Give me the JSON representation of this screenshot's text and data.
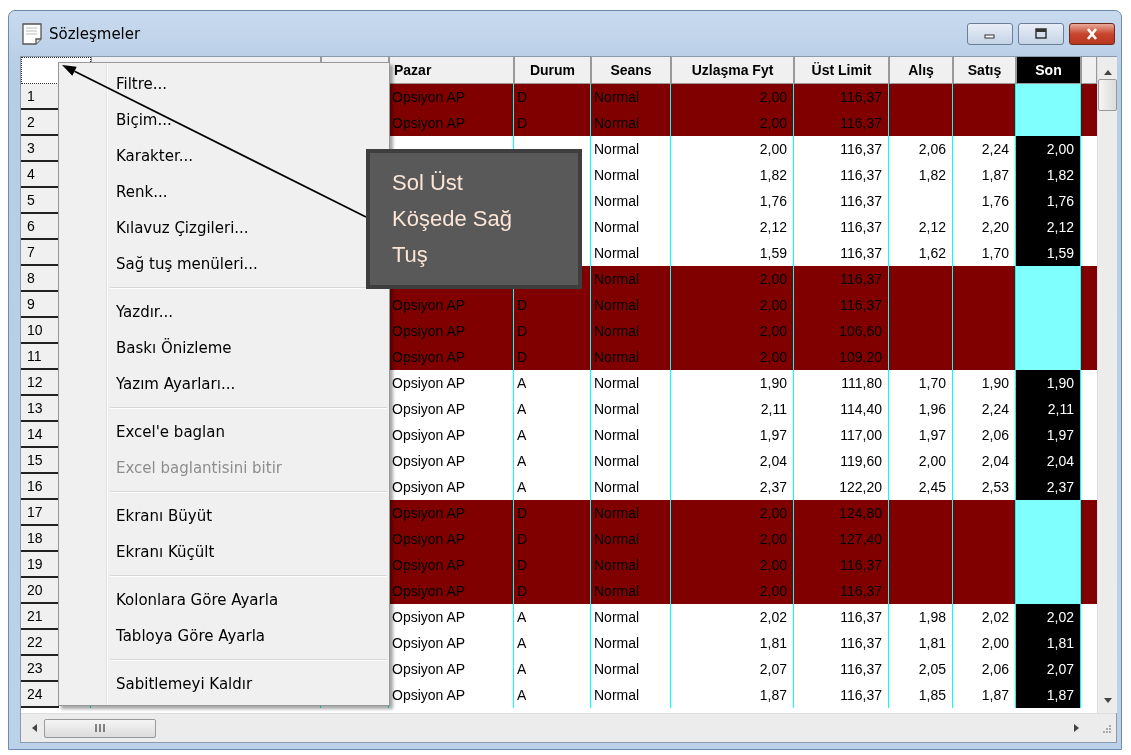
{
  "window": {
    "title": "Sözleşmeler"
  },
  "table": {
    "columns": [
      {
        "label": "Pazar",
        "selected": false
      },
      {
        "label": "Durum",
        "selected": false
      },
      {
        "label": "Seans",
        "selected": false
      },
      {
        "label": "Uzlaşma Fyt",
        "selected": false
      },
      {
        "label": "Üst Limit",
        "selected": false
      },
      {
        "label": "Alış",
        "selected": false
      },
      {
        "label": "Satış",
        "selected": false
      },
      {
        "label": "Son",
        "selected": true
      }
    ],
    "rows": [
      {
        "number": "1",
        "halted": true,
        "cells": [
          "Opsiyon AP",
          "D",
          "Normal",
          "2,00",
          "116,37",
          null,
          null,
          null
        ]
      },
      {
        "number": "2",
        "halted": true,
        "cells": [
          "Opsiyon AP",
          "D",
          "Normal",
          "2,00",
          "116,37",
          null,
          null,
          null
        ]
      },
      {
        "number": "3",
        "halted": false,
        "cells": [
          null,
          null,
          "Normal",
          "2,00",
          "116,37",
          "2,06",
          "2,24",
          "2,00"
        ]
      },
      {
        "number": "4",
        "halted": false,
        "cells": [
          null,
          null,
          "Normal",
          "1,82",
          "116,37",
          "1,82",
          "1,87",
          "1,82"
        ]
      },
      {
        "number": "5",
        "halted": false,
        "cells": [
          null,
          null,
          "Normal",
          "1,76",
          "116,37",
          null,
          "1,76",
          "1,76"
        ]
      },
      {
        "number": "6",
        "halted": false,
        "cells": [
          null,
          null,
          "Normal",
          "2,12",
          "116,37",
          "2,12",
          "2,20",
          "2,12"
        ]
      },
      {
        "number": "7",
        "halted": false,
        "cells": [
          null,
          null,
          "Normal",
          "1,59",
          "116,37",
          "1,62",
          "1,70",
          "1,59"
        ]
      },
      {
        "number": "8",
        "halted": true,
        "cells": [
          null,
          null,
          "Normal",
          "2,00",
          "116,37",
          null,
          null,
          null
        ]
      },
      {
        "number": "9",
        "halted": true,
        "cells": [
          "Opsiyon AP",
          "D",
          "Normal",
          "2,00",
          "116,37",
          null,
          null,
          null
        ]
      },
      {
        "number": "10",
        "halted": true,
        "cells": [
          "Opsiyon AP",
          "D",
          "Normal",
          "2,00",
          "106,60",
          null,
          null,
          null
        ]
      },
      {
        "number": "11",
        "halted": true,
        "cells": [
          "Opsiyon AP",
          "D",
          "Normal",
          "2,00",
          "109,20",
          null,
          null,
          null
        ]
      },
      {
        "number": "12",
        "halted": false,
        "cells": [
          "Opsiyon AP",
          "A",
          "Normal",
          "1,90",
          "111,80",
          "1,70",
          "1,90",
          "1,90"
        ]
      },
      {
        "number": "13",
        "halted": false,
        "cells": [
          "Opsiyon AP",
          "A",
          "Normal",
          "2,11",
          "114,40",
          "1,96",
          "2,24",
          "2,11"
        ]
      },
      {
        "number": "14",
        "halted": false,
        "cells": [
          "Opsiyon AP",
          "A",
          "Normal",
          "1,97",
          "117,00",
          "1,97",
          "2,06",
          "1,97"
        ]
      },
      {
        "number": "15",
        "halted": false,
        "cells": [
          "Opsiyon AP",
          "A",
          "Normal",
          "2,04",
          "119,60",
          "2,00",
          "2,04",
          "2,04"
        ]
      },
      {
        "number": "16",
        "halted": false,
        "cells": [
          "Opsiyon AP",
          "A",
          "Normal",
          "2,37",
          "122,20",
          "2,45",
          "2,53",
          "2,37"
        ]
      },
      {
        "number": "17",
        "halted": true,
        "cells": [
          "Opsiyon AP",
          "D",
          "Normal",
          "2,00",
          "124,80",
          null,
          null,
          null
        ]
      },
      {
        "number": "18",
        "halted": true,
        "cells": [
          "Opsiyon AP",
          "D",
          "Normal",
          "2,00",
          "127,40",
          null,
          null,
          null
        ]
      },
      {
        "number": "19",
        "halted": true,
        "cells": [
          "Opsiyon AP",
          "D",
          "Normal",
          "2,00",
          "116,37",
          null,
          null,
          null
        ]
      },
      {
        "number": "20",
        "halted": true,
        "cells": [
          "Opsiyon AP",
          "D",
          "Normal",
          "2,00",
          "116,37",
          null,
          null,
          null
        ]
      },
      {
        "number": "21",
        "halted": false,
        "cells": [
          "Opsiyon AP",
          "A",
          "Normal",
          "2,02",
          "116,37",
          "1,98",
          "2,02",
          "2,02"
        ]
      },
      {
        "number": "22",
        "halted": false,
        "cells": [
          "Opsiyon AP",
          "A",
          "Normal",
          "1,81",
          "116,37",
          "1,81",
          "2,00",
          "1,81"
        ]
      },
      {
        "number": "23",
        "halted": false,
        "cells": [
          "Opsiyon AP",
          "A",
          "Normal",
          "2,07",
          "116,37",
          "2,05",
          "2,06",
          "2,07"
        ]
      },
      {
        "number": "24",
        "halted": false,
        "cells": [
          "Opsiyon AP",
          "A",
          "Normal",
          "1,87",
          "116,37",
          "1,85",
          "1,87",
          "1,87"
        ]
      }
    ]
  },
  "context_menu": {
    "groups": [
      [
        {
          "label": "Filtre...",
          "disabled": false
        },
        {
          "label": "Biçim...",
          "disabled": false
        },
        {
          "label": "Karakter...",
          "disabled": false
        },
        {
          "label": "Renk...",
          "disabled": false
        },
        {
          "label": "Kılavuz Çizgileri...",
          "disabled": false
        },
        {
          "label": "Sağ tuş menüleri...",
          "disabled": false
        }
      ],
      [
        {
          "label": "Yazdır...",
          "disabled": false
        },
        {
          "label": "Baskı Önizleme",
          "disabled": false
        },
        {
          "label": "Yazım Ayarları...",
          "disabled": false
        }
      ],
      [
        {
          "label": "Excel'e baglan",
          "disabled": false
        },
        {
          "label": "Excel baglantisini bitir",
          "disabled": true
        }
      ],
      [
        {
          "label": "Ekranı Büyüt",
          "disabled": false
        },
        {
          "label": "Ekranı Küçült",
          "disabled": false
        }
      ],
      [
        {
          "label": "Kolonlara Göre Ayarla",
          "disabled": false
        },
        {
          "label": "Tabloya Göre Ayarla",
          "disabled": false
        }
      ],
      [
        {
          "label": "Sabitlemeyi Kaldır",
          "disabled": false
        }
      ]
    ]
  },
  "callout": {
    "lines": [
      "Sol Üst",
      "Köşede Sağ",
      "Tuş"
    ]
  }
}
